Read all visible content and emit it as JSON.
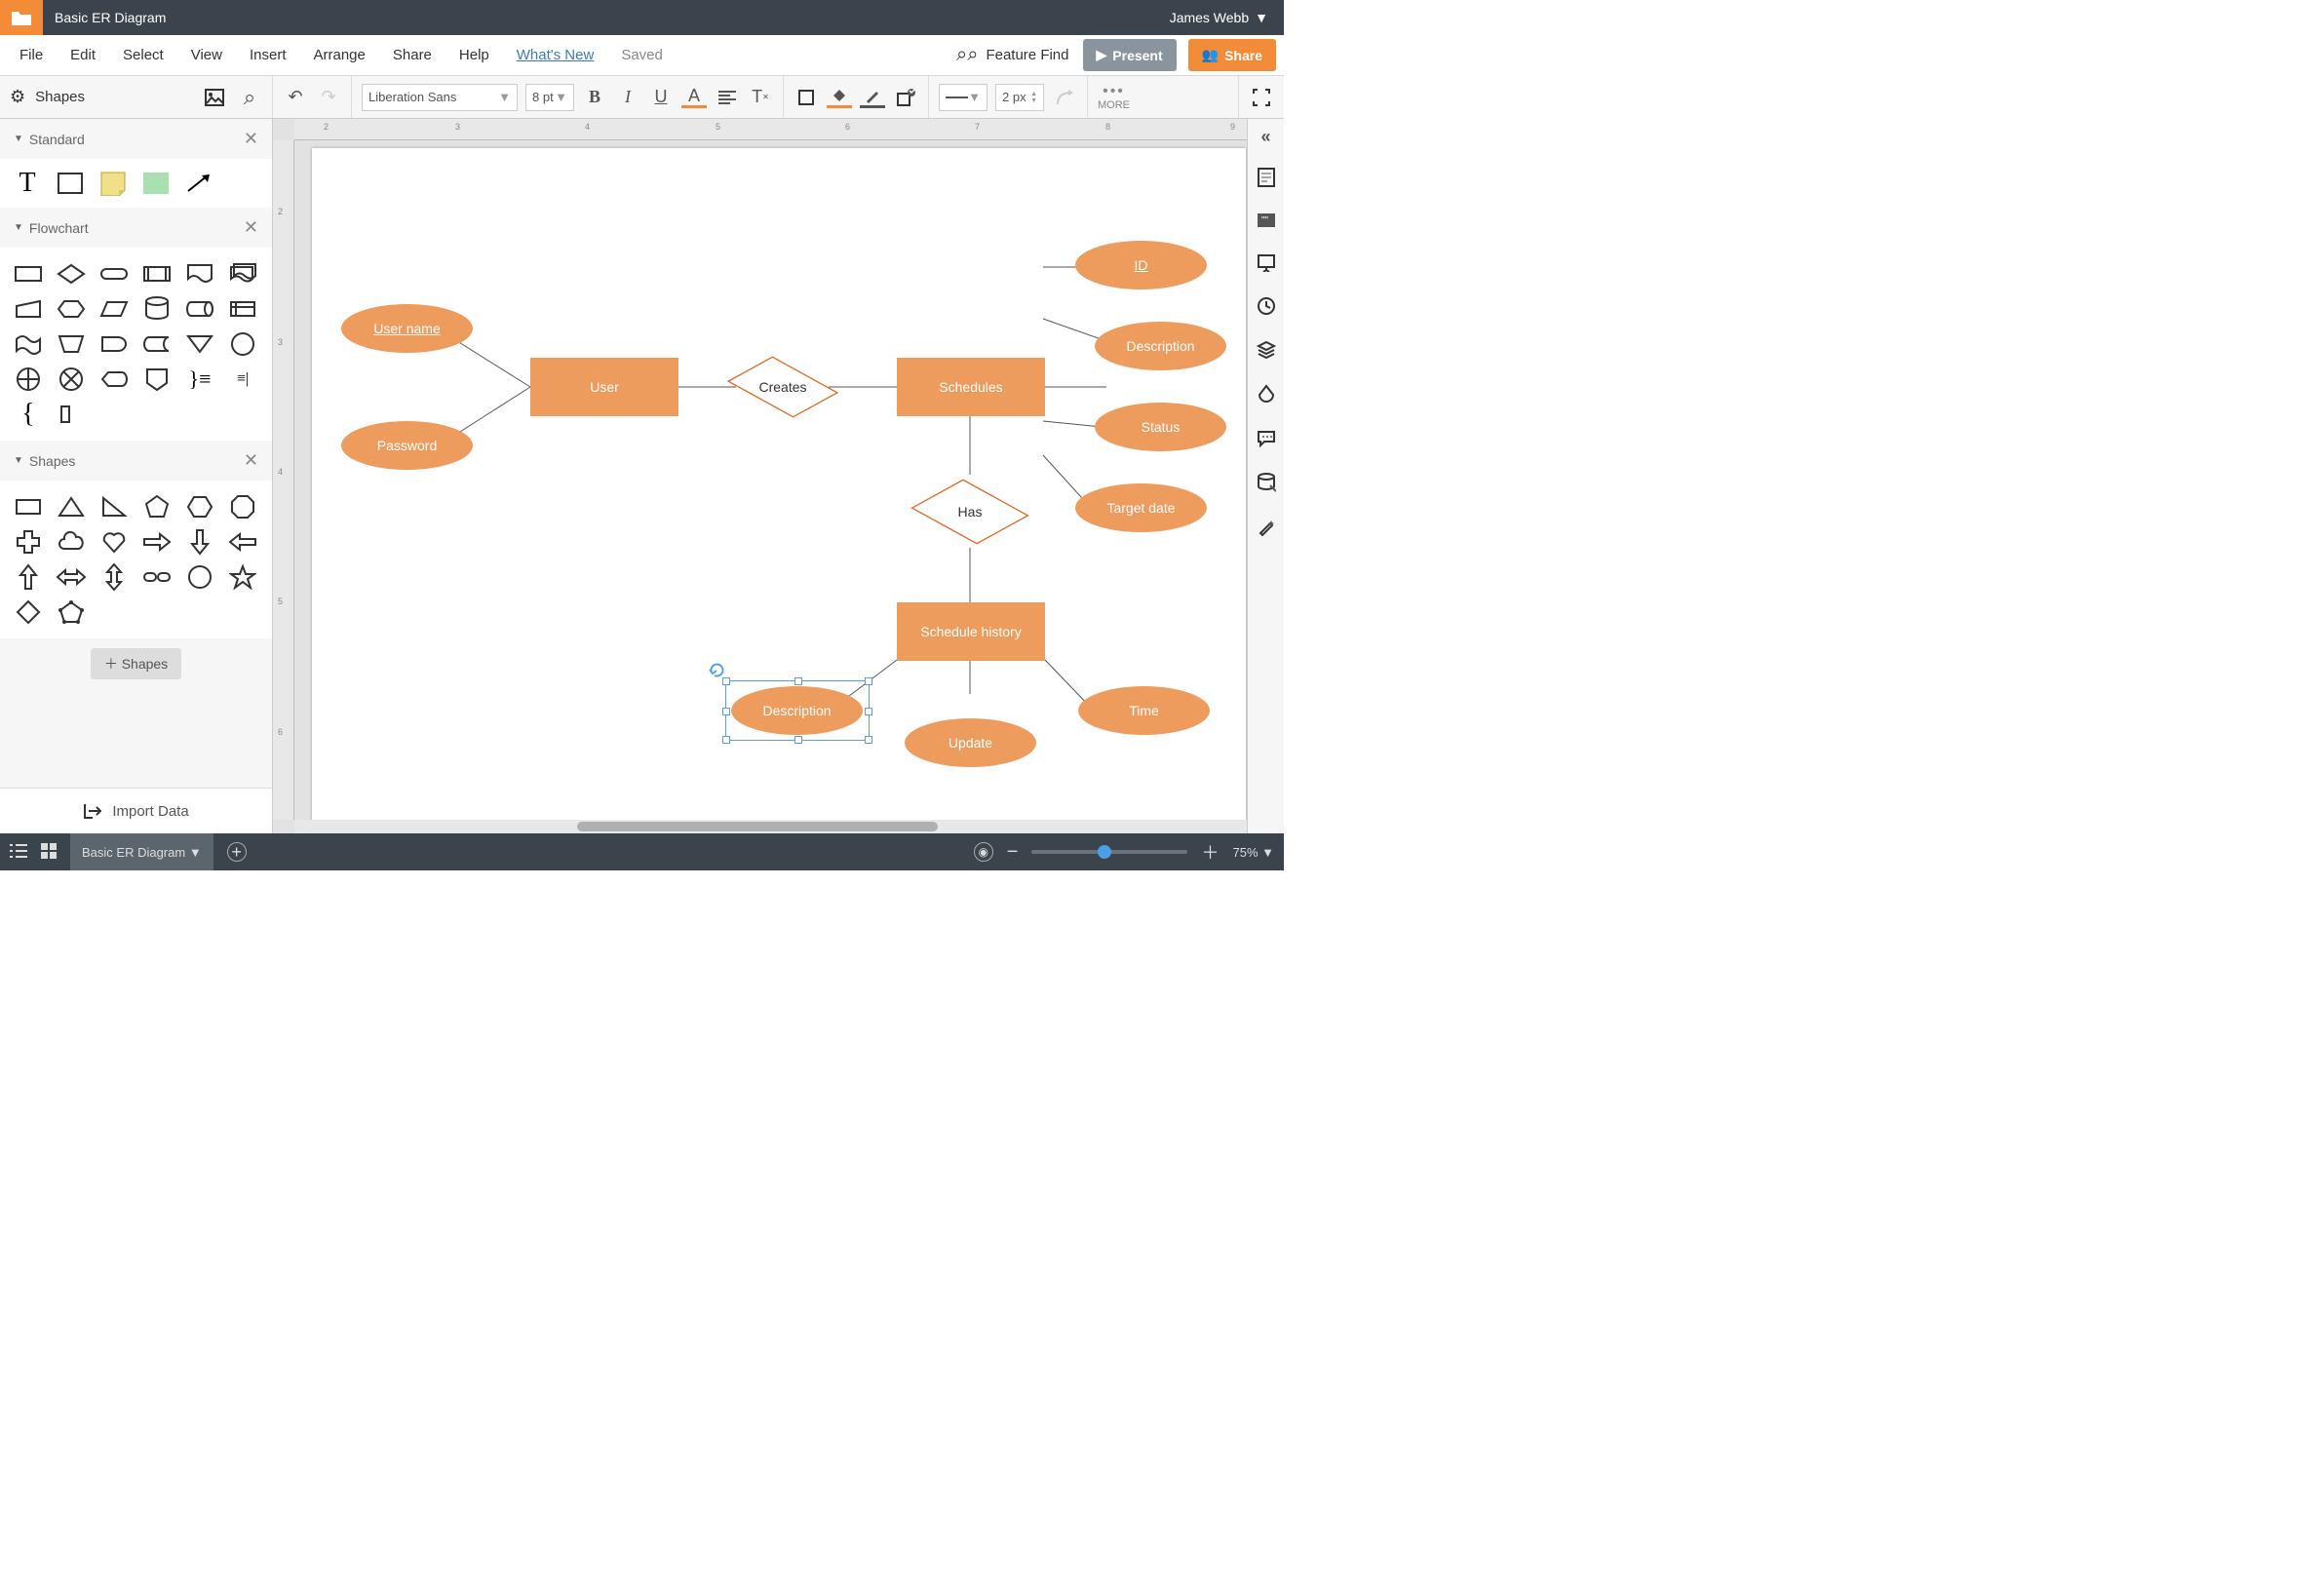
{
  "doc": {
    "title": "Basic ER Diagram",
    "user": "James Webb",
    "saved": "Saved"
  },
  "menu": {
    "file": "File",
    "edit": "Edit",
    "select": "Select",
    "view": "View",
    "insert": "Insert",
    "arrange": "Arrange",
    "share": "Share",
    "help": "Help",
    "whatsnew": "What's New"
  },
  "actions": {
    "featurefind": "Feature Find",
    "present": "Present",
    "share": "Share"
  },
  "toolbar": {
    "shapes": "Shapes",
    "font": "Liberation Sans",
    "fontsize": "8 pt",
    "linewidth": "2 px",
    "more": "MORE"
  },
  "panels": {
    "standard": "Standard",
    "flowchart": "Flowchart",
    "shapes": "Shapes",
    "addshapes": "Shapes",
    "import": "Import Data"
  },
  "er": {
    "username": "User name",
    "password": "Password",
    "user": "User",
    "creates": "Creates",
    "schedules": "Schedules",
    "id": "ID",
    "description": "Description",
    "status": "Status",
    "targetdate": "Target date",
    "has": "Has",
    "schedhist": "Schedule history",
    "desc2": "Description",
    "update": "Update",
    "time": "Time"
  },
  "bottom": {
    "tab": "Basic ER Diagram",
    "zoom": "75%"
  }
}
